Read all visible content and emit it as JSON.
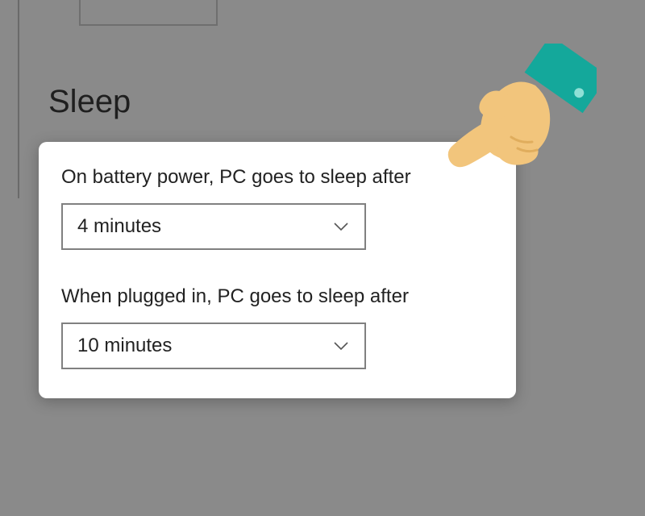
{
  "section": {
    "heading": "Sleep"
  },
  "sleep": {
    "battery": {
      "label": "On battery power, PC goes to sleep after",
      "value": "4 minutes"
    },
    "plugged": {
      "label": "When plugged in, PC goes to sleep after",
      "value": "10 minutes"
    }
  },
  "colors": {
    "cuff": "#14a89b",
    "skin": "#f2c57c"
  }
}
